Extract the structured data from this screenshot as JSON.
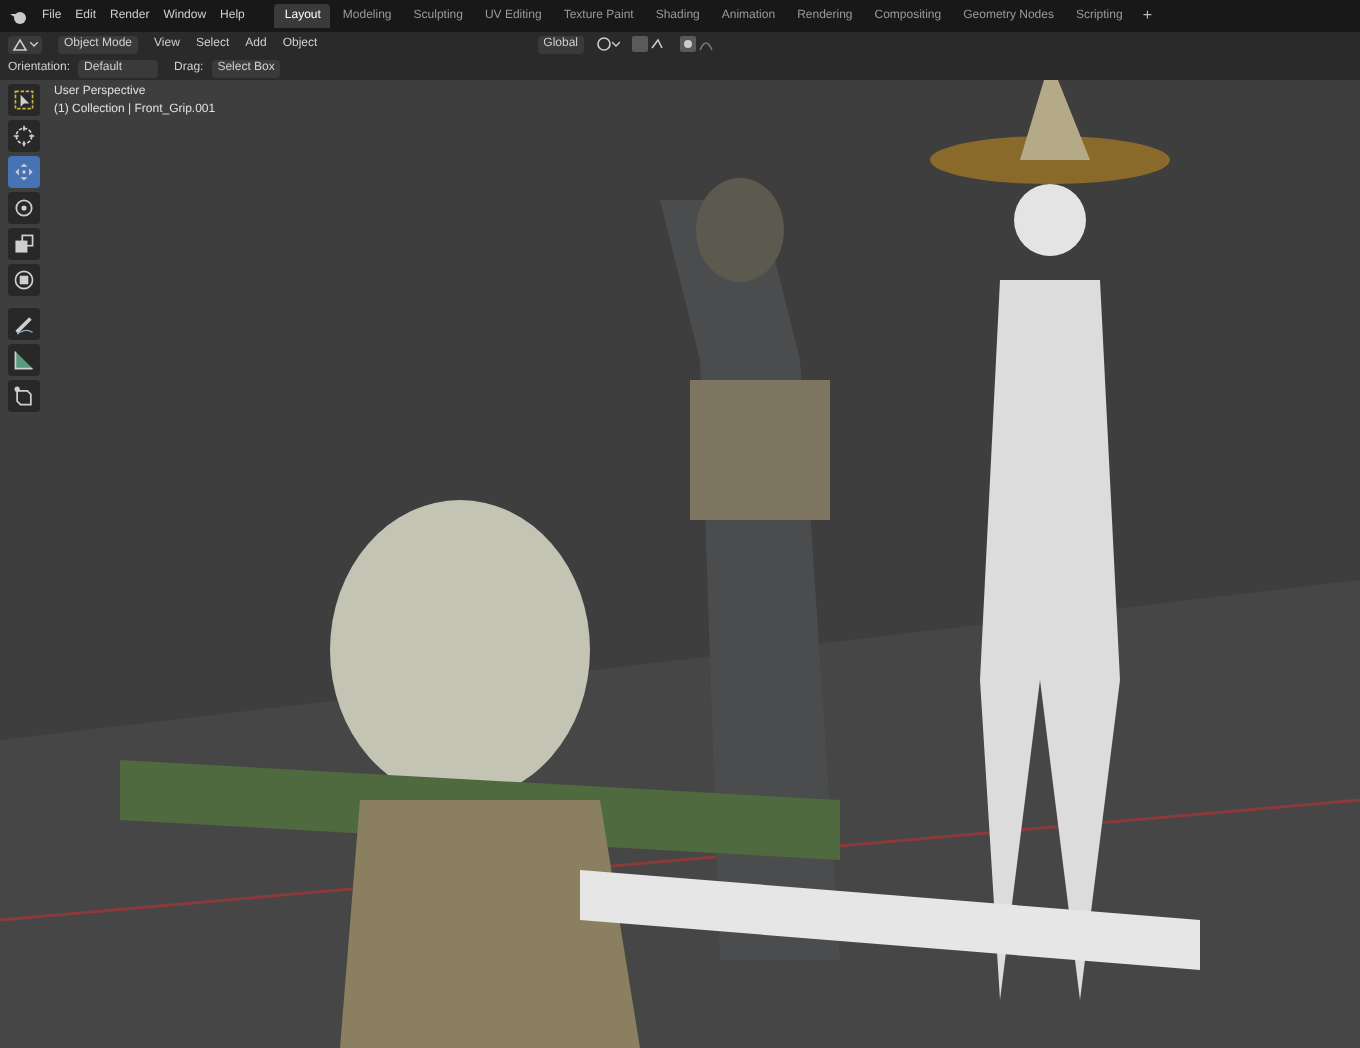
{
  "menu": [
    "File",
    "Edit",
    "Render",
    "Window",
    "Help"
  ],
  "workspaces": [
    {
      "label": "Layout",
      "selected": true
    },
    {
      "label": "Modeling",
      "selected": false
    },
    {
      "label": "Sculpting",
      "selected": false
    },
    {
      "label": "UV Editing",
      "selected": false
    },
    {
      "label": "Texture Paint",
      "selected": false
    },
    {
      "label": "Shading",
      "selected": false
    },
    {
      "label": "Animation",
      "selected": false
    },
    {
      "label": "Rendering",
      "selected": false
    },
    {
      "label": "Compositing",
      "selected": false
    },
    {
      "label": "Geometry Nodes",
      "selected": false
    },
    {
      "label": "Scripting",
      "selected": false
    }
  ],
  "add_workspace": "+",
  "header": {
    "mode": "Object Mode",
    "menus": [
      "View",
      "Select",
      "Add",
      "Object"
    ],
    "orientation": "Global"
  },
  "tool_settings": {
    "orientation_label": "Orientation:",
    "orientation": "Default",
    "drag_label": "Drag:",
    "drag": "Select Box"
  },
  "tools": [
    {
      "kind": "select",
      "selected": false
    },
    {
      "kind": "cursor",
      "selected": false
    },
    {
      "kind": "move",
      "selected": true
    },
    {
      "kind": "rotate",
      "selected": false
    },
    {
      "kind": "scale",
      "selected": false
    },
    {
      "kind": "transform",
      "selected": false
    },
    {
      "kind": "annotate",
      "selected": false
    },
    {
      "kind": "measure",
      "selected": false
    },
    {
      "kind": "addcube",
      "selected": false
    }
  ],
  "viewport": {
    "view": "User Perspective",
    "object": "(1) Collection | Front_Grip.001"
  }
}
